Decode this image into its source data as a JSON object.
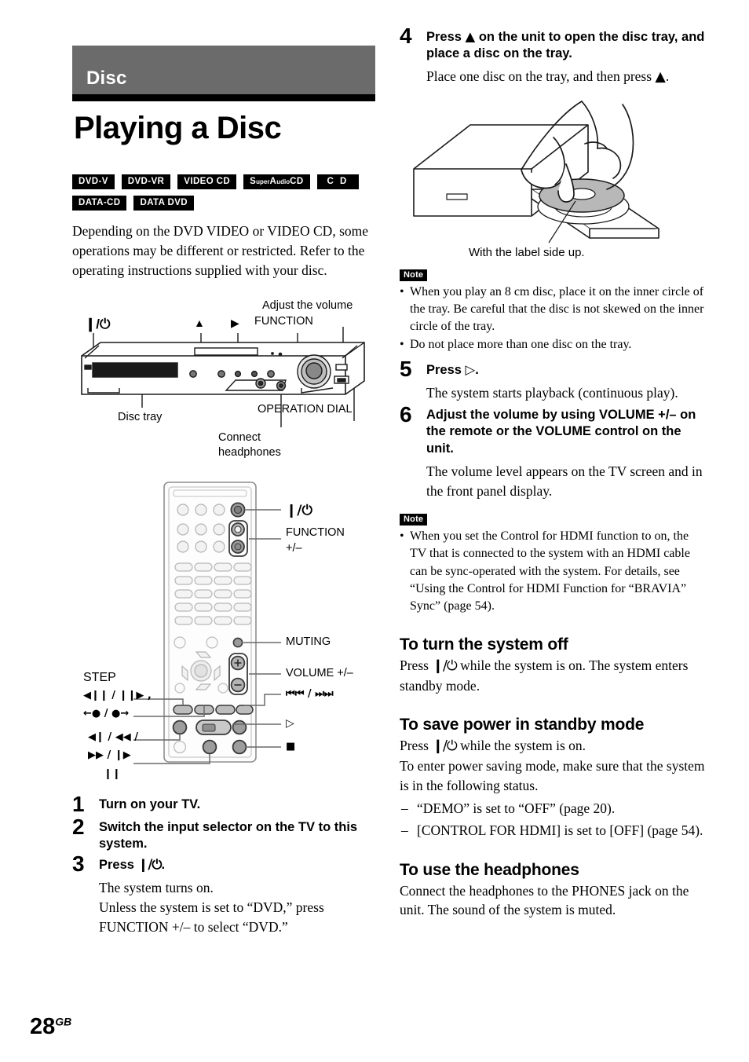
{
  "section": {
    "label": "Disc"
  },
  "title": "Playing a Disc",
  "badges": [
    [
      {
        "text": "DVD-V"
      },
      {
        "text": "DVD-VR"
      },
      {
        "text": "VIDEO CD"
      },
      {
        "text": "SuperAudioCD",
        "pre": "S",
        "small1": "uper",
        "mid": "A",
        "small2": "udio",
        "post": "CD"
      },
      {
        "text": "C D"
      }
    ],
    [
      {
        "text": "DATA-CD"
      },
      {
        "text": "DATA DVD"
      }
    ]
  ],
  "intro": "Depending on the DVD VIDEO or VIDEO CD, some operations may be different or restricted. Refer to the operating instructions supplied with your disc.",
  "unit_figure": {
    "name": "front-panel-diagram",
    "labels": {
      "power": "❙/⏻",
      "eject": "▲",
      "play": "▶",
      "function": "FUNCTION",
      "adjust_volume": "Adjust the volume",
      "disc_tray": "Disc tray",
      "operation_dial": "OPERATION DIAL",
      "connect_headphones_l1": "Connect",
      "connect_headphones_l2": "headphones"
    }
  },
  "remote_figure": {
    "name": "remote-control-diagram",
    "labels": {
      "power": "❙/⏻",
      "function_l1": "FUNCTION",
      "function_l2": "+/–",
      "muting": "MUTING",
      "volume": "VOLUME +/–",
      "skip": "⏮⏮ / ⏭⏭",
      "play": "▷",
      "stop": "■",
      "pause": "❙❙",
      "step": "STEP",
      "step_l1": "◀❙❙ / ❙❙▶ ,",
      "step_l2": "←● / ●→",
      "slow_l1": "◀❙ / ◀◀ /",
      "slow_l2": "▶▶ / ❙▶"
    }
  },
  "steps": [
    {
      "num": "1",
      "heading": "Turn on your TV.",
      "sub": []
    },
    {
      "num": "2",
      "heading": "Switch the input selector on the TV to this system.",
      "sub": []
    },
    {
      "num": "3",
      "heading_pre": "Press ",
      "heading_glyph": "❙/⏻",
      "heading_post": ".",
      "sub": [
        "The system turns on.",
        "Unless the system is set to “DVD,” press FUNCTION +/– to select “DVD.”"
      ]
    },
    {
      "num": "4",
      "heading_pre": "Press ",
      "heading_glyph": "▲",
      "heading_post": " on the unit to open the disc tray, and place a disc on the tray.",
      "sub_pre": "Place one disc on the tray, and then press ",
      "sub_glyph": "▲",
      "sub_post": "."
    },
    {
      "num": "5",
      "heading_pre": "Press ",
      "heading_glyph": "▷",
      "heading_post": ".",
      "sub": [
        "The system starts playback (continuous play)."
      ]
    },
    {
      "num": "6",
      "heading": "Adjust the volume by using VOLUME +/– on the remote or the VOLUME control on the unit.",
      "sub": [
        "The volume level appears on the TV screen and in the front panel display."
      ]
    }
  ],
  "tray_figure": {
    "caption": "With the label side up."
  },
  "note_label": "Note",
  "note_1": [
    "When you play an 8 cm disc, place it on the inner circle of the tray. Be careful that the disc is not skewed on the inner circle of the tray.",
    "Do not place more than one disc on the tray."
  ],
  "note_2": [
    "When you set the Control for HDMI function to on, the TV that is connected to the system with an HDMI cable can be sync-operated with the system. For details, see “Using the Control for HDMI Function for “BRAVIA” Sync” (page 54)."
  ],
  "sections": {
    "turn_off": {
      "heading": "To turn the system off",
      "body_pre": "Press ",
      "body_glyph": "❙/⏻",
      "body_post": " while the system is on. The system enters standby mode."
    },
    "save_power": {
      "heading": "To save power in standby mode",
      "body_pre": "Press ",
      "body_glyph": "❙/⏻",
      "body_post": " while the system is on.",
      "body2": "To enter power saving mode, make sure that the system is in the following status.",
      "items": [
        "“DEMO” is set to “OFF” (page 20).",
        "[CONTROL FOR HDMI] is set to [OFF] (page 54)."
      ]
    },
    "headphones": {
      "heading": "To use the headphones",
      "body": "Connect the headphones to the PHONES jack on the unit. The sound of the system is muted."
    }
  },
  "page_number": {
    "num": "28",
    "sup": "GB"
  },
  "colors": {
    "section_bar": "#6b6b6b",
    "rule": "#000000",
    "badge_bg": "#000000"
  }
}
